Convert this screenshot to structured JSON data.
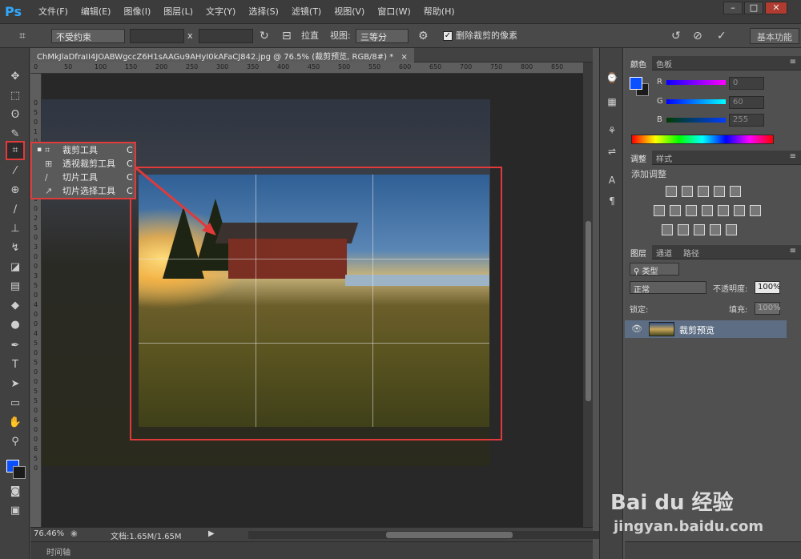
{
  "app": {
    "logo": "Ps",
    "menus": [
      "文件(F)",
      "编辑(E)",
      "图像(I)",
      "图层(L)",
      "文字(Y)",
      "选择(S)",
      "滤镜(T)",
      "视图(V)",
      "窗口(W)",
      "帮助(H)"
    ],
    "window_controls": [
      "–",
      "□",
      "✕"
    ]
  },
  "options_bar": {
    "ratio": "不受约束",
    "x_sep": "x",
    "straighten": "拉直",
    "view_label": "视图:",
    "view_value": "三等分",
    "delete_cropped": "删除裁剪的像素",
    "workspace": "基本功能"
  },
  "document": {
    "tab_title": "ChMkJlaDfraII4JOABWgccZ6H1sAAGu9AHyI0kAFaCJ842.jpg @ 76.5% (裁剪预览, RGB/8#) *"
  },
  "rulers": {
    "h_ticks": [
      "0",
      "50",
      "100",
      "150",
      "200",
      "250",
      "300",
      "350",
      "400",
      "450",
      "500",
      "550",
      "600",
      "650",
      "700",
      "750",
      "800",
      "850"
    ],
    "v_ticks": [
      "0",
      "5",
      "0",
      "1",
      "0",
      "0",
      "1",
      "5",
      "0",
      "2",
      "0",
      "0",
      "2",
      "5",
      "0",
      "3",
      "0",
      "0",
      "3",
      "5",
      "0",
      "4",
      "0",
      "0",
      "4",
      "5",
      "0",
      "5",
      "0",
      "0",
      "5",
      "5",
      "0",
      "6",
      "0",
      "0",
      "6",
      "5",
      "0"
    ]
  },
  "flyout": {
    "items": [
      {
        "label": "裁剪工具",
        "key": "C",
        "current": "▪"
      },
      {
        "label": "透视裁剪工具",
        "key": "C",
        "current": ""
      },
      {
        "label": "切片工具",
        "key": "C",
        "current": ""
      },
      {
        "label": "切片选择工具",
        "key": "C",
        "current": ""
      }
    ]
  },
  "status": {
    "zoom": "76.46%",
    "doc_size": "文档:1.65M/1.65M",
    "timeline": "时间轴"
  },
  "color_panel": {
    "tabs": [
      "颜色",
      "色板"
    ],
    "channels": [
      {
        "name": "R",
        "value": "0"
      },
      {
        "name": "G",
        "value": "60"
      },
      {
        "name": "B",
        "value": "255"
      }
    ],
    "foreground": "#0a50ff",
    "background": "#1b1b1b"
  },
  "adjust_panel": {
    "tabs": [
      "调整",
      "样式"
    ],
    "title": "添加调整"
  },
  "layers_panel": {
    "tabs": [
      "图层",
      "通道",
      "路径"
    ],
    "filter": "类型",
    "blend_mode": "正常",
    "opacity_label": "不透明度:",
    "opacity_value": "100%",
    "lock_label": "锁定:",
    "fill_label": "填充:",
    "fill_value": "100%",
    "layer_name": "裁剪预览"
  },
  "watermark": {
    "brand": "Bai du 经验",
    "url": "jingyan.baidu.com"
  }
}
